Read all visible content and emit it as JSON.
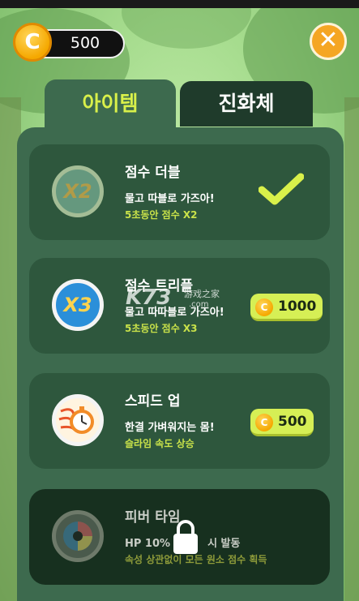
{
  "header": {
    "coin_symbol": "C",
    "coins": "500",
    "close_symbol": "✕"
  },
  "tabs": [
    {
      "label": "아이템",
      "active": true
    },
    {
      "label": "진화체",
      "active": false
    }
  ],
  "items": [
    {
      "title": "점수 더블",
      "desc": "물고 따블로 가즈아!",
      "sub": "5초동안 점수 X2",
      "icon_text": "X2",
      "icon": "x2-badge-icon",
      "state": "owned"
    },
    {
      "title": "점수 트리플",
      "desc": "물고 따따블로 가즈아!",
      "sub": "5초동안 점수 X3",
      "icon_text": "X3",
      "icon": "x3-badge-icon",
      "price": "1000"
    },
    {
      "title": "스피드 업",
      "desc": "한결 가벼워지는 몸!",
      "sub": "슬라임 속도 상승",
      "icon": "stopwatch-icon",
      "price": "500"
    },
    {
      "title": "피버 타임",
      "desc_prefix": "HP 10%",
      "desc_suffix": "시 발동",
      "sub": "속성 상관없이 모든 원소 점수 획득",
      "icon": "fever-orb-icon",
      "state": "locked"
    }
  ],
  "watermark": {
    "logo": "K73",
    "cn": "游戏之家",
    "domain": ".com"
  },
  "colors": {
    "accent_yellow": "#d9f04a",
    "panel": "#3d6a4e",
    "card": "#2e573d",
    "coin": "#f5a800",
    "close": "#f5a623"
  }
}
